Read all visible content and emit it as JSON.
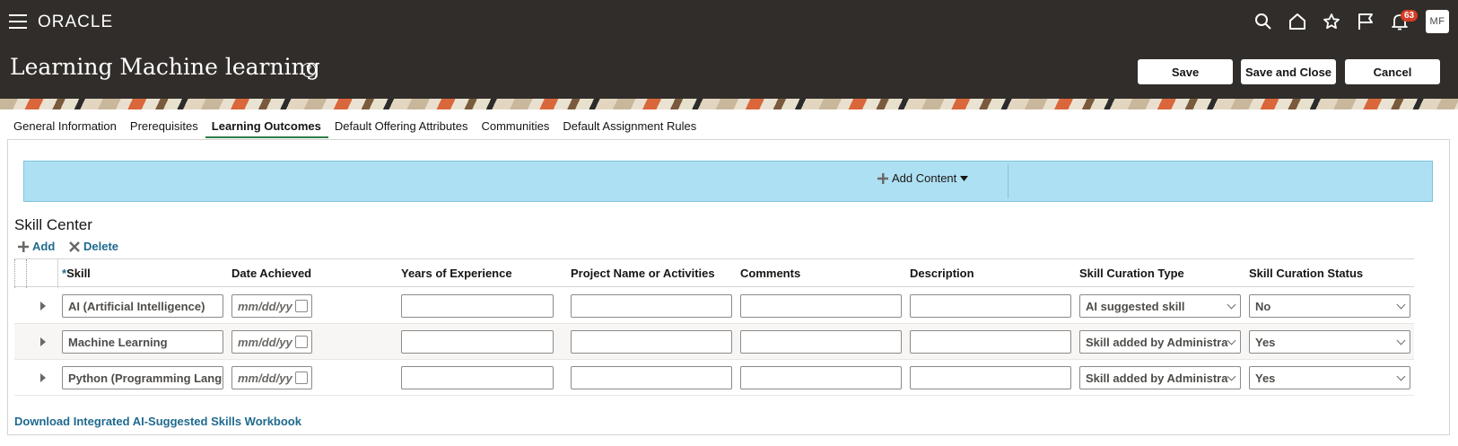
{
  "header": {
    "logo": "ORACLE",
    "page_title": "Learning Machine learning",
    "notification_count": "63",
    "avatar_initials": "MF",
    "save_label": "Save",
    "save_close_label": "Save and Close",
    "cancel_label": "Cancel",
    "icons": [
      "menu-icon",
      "search-icon",
      "home-icon",
      "star-icon",
      "flag-icon",
      "bell-icon",
      "help-icon"
    ]
  },
  "tabs": [
    {
      "label": "General Information",
      "active": false
    },
    {
      "label": "Prerequisites",
      "active": false
    },
    {
      "label": "Learning Outcomes",
      "active": true
    },
    {
      "label": "Default Offering Attributes",
      "active": false
    },
    {
      "label": "Communities",
      "active": false
    },
    {
      "label": "Default Assignment Rules",
      "active": false
    }
  ],
  "content_bar": {
    "add_content_label": "Add Content"
  },
  "skill_center": {
    "title": "Skill Center",
    "add_label": "Add",
    "delete_label": "Delete",
    "required_marker": "*",
    "columns": [
      "Skill",
      "Date Achieved",
      "Years of Experience",
      "Project Name or Activities",
      "Comments",
      "Description",
      "Skill Curation Type",
      "Skill Curation Status"
    ],
    "rows": [
      {
        "skill": "AI (Artificial Intelligence)",
        "date_placeholder": "mm/dd/yy",
        "years": "",
        "project": "",
        "comments": "",
        "description": "",
        "curation_type": "AI suggested skill",
        "curation_status": "No"
      },
      {
        "skill": "Machine Learning",
        "date_placeholder": "mm/dd/yy",
        "years": "",
        "project": "",
        "comments": "",
        "description": "",
        "curation_type": "Skill added by Administra",
        "curation_status": "Yes"
      },
      {
        "skill": "Python (Programming Langu",
        "date_placeholder": "mm/dd/yy",
        "years": "",
        "project": "",
        "comments": "",
        "description": "",
        "curation_type": "Skill added by Administra",
        "curation_status": "Yes"
      }
    ]
  },
  "download_link": "Download Integrated AI-Suggested Skills Workbook",
  "colors": {
    "header_bg": "#312d2a",
    "active_tab": "#2f7d4a",
    "link": "#1f6a8f",
    "add_bar": "#aee0f3",
    "badge": "#d63b25"
  }
}
